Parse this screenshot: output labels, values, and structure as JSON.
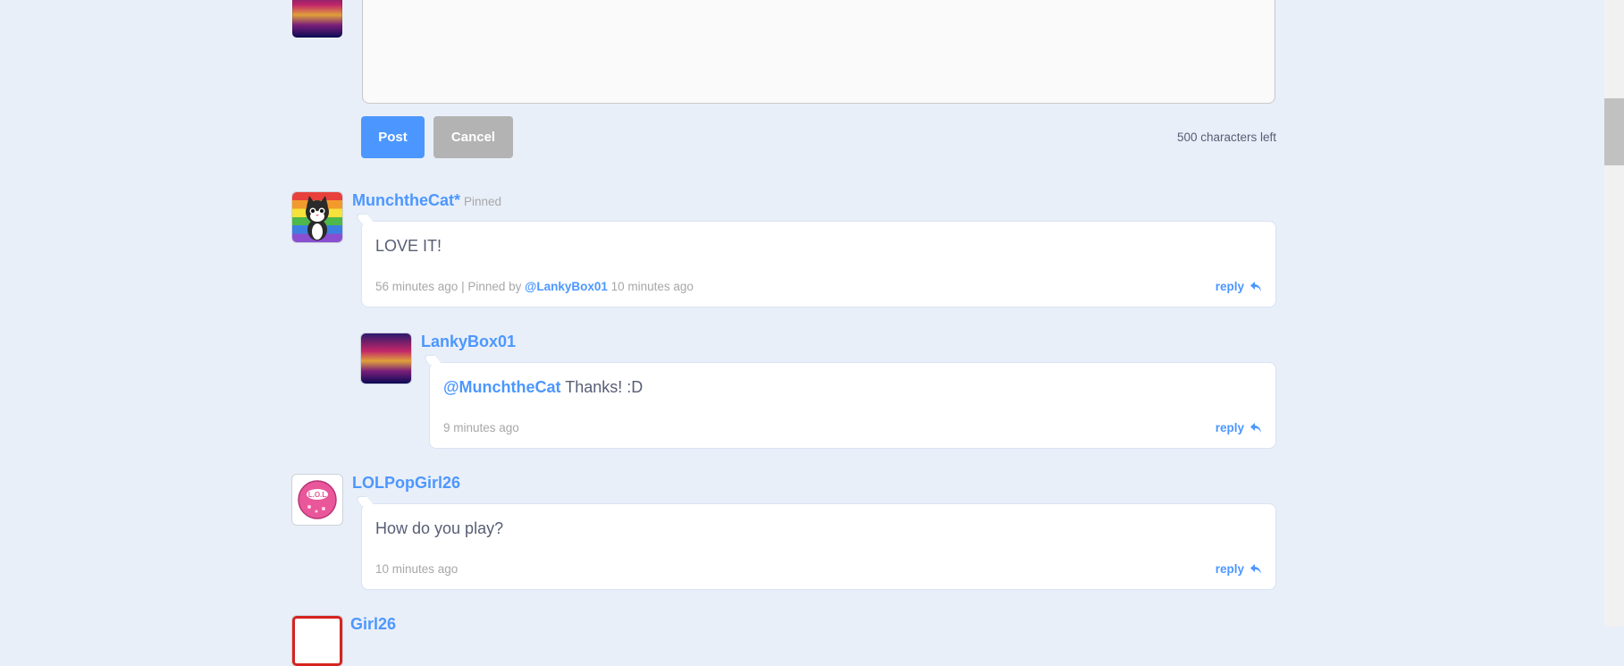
{
  "composer": {
    "post_label": "Post",
    "cancel_label": "Cancel",
    "chars_left": "500 characters left"
  },
  "comments": [
    {
      "username": "MunchtheCat*",
      "pinned_tag": "Pinned",
      "text": "LOVE IT!",
      "time": "56 minutes ago",
      "pinned_by_prefix": "| Pinned by",
      "pinned_by_user": "@LankyBox01",
      "pinned_time": "10 minutes ago",
      "reply_label": "reply",
      "replies": [
        {
          "username": "LankyBox01",
          "mention": "@MunchtheCat",
          "text": " Thanks! :D",
          "time": "9 minutes ago",
          "reply_label": "reply"
        }
      ]
    },
    {
      "username": "LOLPopGirl26",
      "text": "How do you play?",
      "time": "10 minutes ago",
      "reply_label": "reply"
    },
    {
      "username": "Girl26"
    }
  ],
  "colors": {
    "background": "#e9eff9",
    "accent": "#4c97ff",
    "cancel": "#b3b3b3",
    "text": "#575e75",
    "muted": "#a7a7a7"
  },
  "icons": {
    "reply": "reply-arrow-icon"
  }
}
